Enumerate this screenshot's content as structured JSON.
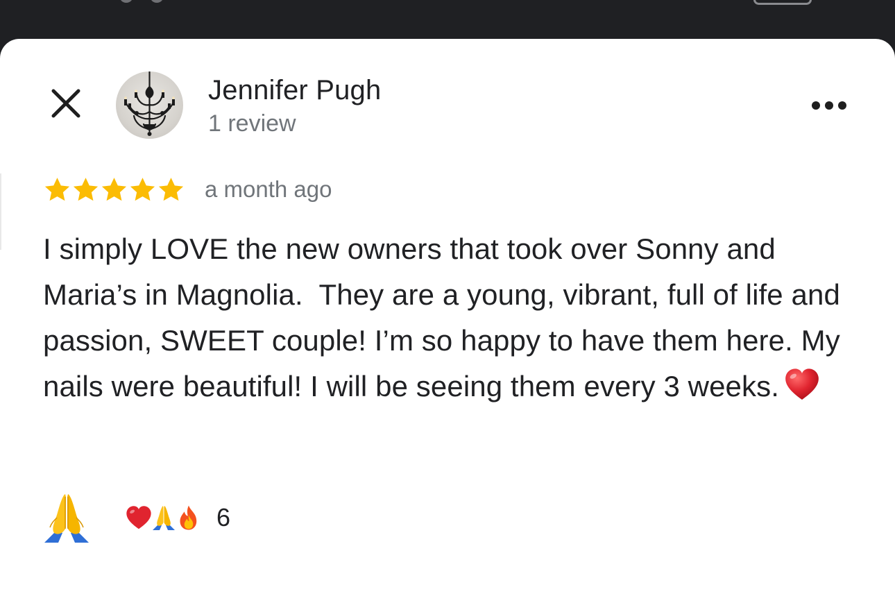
{
  "reviewer": {
    "name": "Jennifer Pugh",
    "meta": "1 review"
  },
  "review": {
    "rating": 5,
    "rating_max": 5,
    "date": "a month ago",
    "text": "I simply LOVE the new owners that took over Sonny and Maria’s in Magnolia.  They are a young, vibrant, full of life and passion, SWEET couple! I’m so happy to have them here. My nails were beautiful! I will be seeing them every 3 weeks."
  },
  "reactions": {
    "icons": [
      "heart-emoji",
      "praying-hands-emoji",
      "fire-emoji"
    ],
    "count": "6"
  },
  "icons": {
    "close": "close-icon",
    "more": "more-options-icon",
    "react": "praying-hands-emoji"
  },
  "colors": {
    "star": "#fbbc04",
    "text_primary": "#202124",
    "text_secondary": "#70757a",
    "heart": "#e0242f",
    "top_bar": "#1f2023"
  }
}
